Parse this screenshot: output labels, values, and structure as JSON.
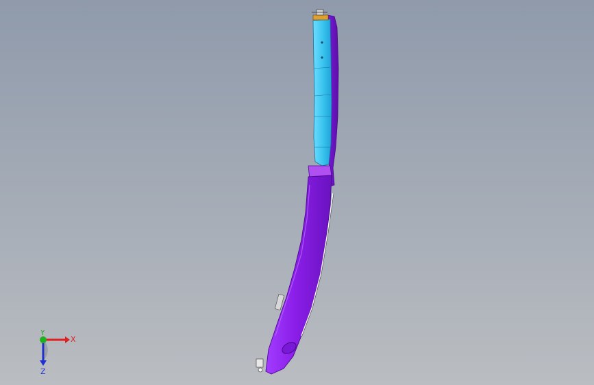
{
  "viewport": {
    "background_top": "#8f9aab",
    "background_bottom": "#babdc1"
  },
  "model": {
    "upper_part_color": "#3cc6f0",
    "lower_part_color": "#8a1ee8",
    "edge_color": "#5a0fa8",
    "fastener_color": "#e0a030"
  },
  "triad": {
    "x_label": "X",
    "y_label": "Y",
    "z_label": "Z",
    "x_color": "#e02020",
    "y_color": "#20b020",
    "z_color": "#2030d0"
  }
}
